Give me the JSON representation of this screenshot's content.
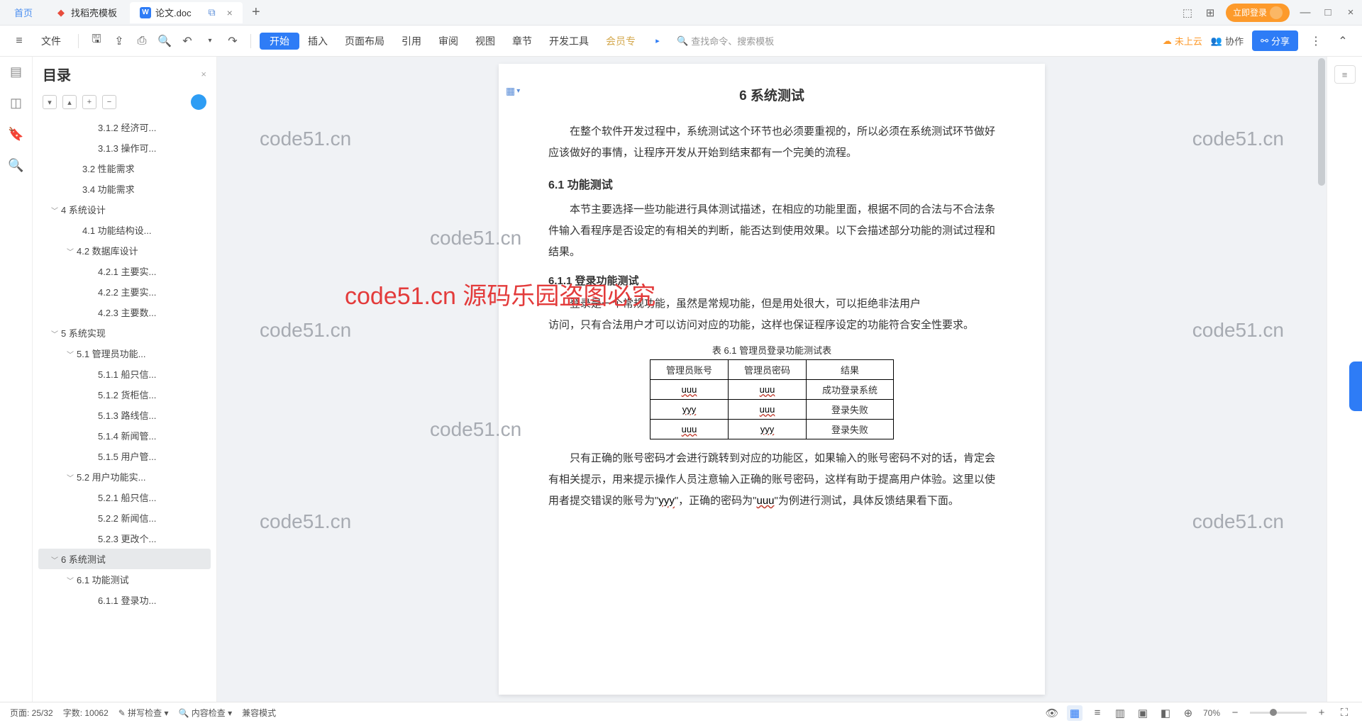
{
  "titlebar": {
    "home": "首页",
    "tab1": "找稻壳模板",
    "tab2": "论文.doc",
    "login": "立即登录"
  },
  "toolbar": {
    "file": "文件",
    "menus": [
      "开始",
      "插入",
      "页面布局",
      "引用",
      "审阅",
      "视图",
      "章节",
      "开发工具",
      "会员专"
    ],
    "search": "查找命令、搜索模板",
    "cloud": "未上云",
    "collab": "协作",
    "share": "分享"
  },
  "outline": {
    "title": "目录",
    "items": [
      {
        "t": "3.1.2 经济可...",
        "l": 4
      },
      {
        "t": "3.1.3 操作可...",
        "l": 4
      },
      {
        "t": "3.2 性能需求",
        "l": 3
      },
      {
        "t": "3.4 功能需求",
        "l": 3
      },
      {
        "t": "4 系统设计",
        "l": 1,
        "c": 1
      },
      {
        "t": "4.1 功能结构设...",
        "l": 3
      },
      {
        "t": "4.2 数据库设计",
        "l": 2,
        "c": 1
      },
      {
        "t": "4.2.1 主要实...",
        "l": 4
      },
      {
        "t": "4.2.2 主要实...",
        "l": 4
      },
      {
        "t": "4.2.3 主要数...",
        "l": 4
      },
      {
        "t": "5 系统实现",
        "l": 1,
        "c": 1
      },
      {
        "t": "5.1 管理员功能...",
        "l": 2,
        "c": 1
      },
      {
        "t": "5.1.1 船只信...",
        "l": 4
      },
      {
        "t": "5.1.2 货柜信...",
        "l": 4
      },
      {
        "t": "5.1.3 路线信...",
        "l": 4
      },
      {
        "t": "5.1.4 新闻管...",
        "l": 4
      },
      {
        "t": "5.1.5 用户管...",
        "l": 4
      },
      {
        "t": "5.2 用户功能实...",
        "l": 2,
        "c": 1
      },
      {
        "t": "5.2.1 船只信...",
        "l": 4
      },
      {
        "t": "5.2.2 新闻信...",
        "l": 4
      },
      {
        "t": "5.2.3 更改个...",
        "l": 4
      },
      {
        "t": "6 系统测试",
        "l": 1,
        "c": 1,
        "sel": 1
      },
      {
        "t": "6.1 功能测试",
        "l": 2,
        "c": 1
      },
      {
        "t": "6.1.1 登录功...",
        "l": 4
      }
    ]
  },
  "doc": {
    "h1": "6 系统测试",
    "p1": "在整个软件开发过程中，系统测试这个环节也必须要重视的，所以必须在系统测试环节做好应该做好的事情，让程序开发从开始到结束都有一个完美的流程。",
    "h2_1": "6.1 功能测试",
    "p2": "本节主要选择一些功能进行具体测试描述，在相应的功能里面，根据不同的合法与不合法条件输入看程序是否设定的有相关的判断，能否达到使用效果。以下会描述部分功能的测试过程和结果。",
    "h3_1": "6.1.1 登录功能测试",
    "p3a": "登录是一个常规功能，虽然是常规功能，但是用处很大，可以拒绝非法用户",
    "p3b": "访问，只有合法用户才可以访问对应的功能，这样也保证程序设定的功能符合安全性要求。",
    "caption": "表 6.1 管理员登录功能测试表",
    "th": [
      "管理员账号",
      "管理员密码",
      "结果"
    ],
    "rows": [
      [
        "uuu",
        "uuu",
        "成功登录系统"
      ],
      [
        "yyy",
        "uuu",
        "登录失败"
      ],
      [
        "uuu",
        "yyy",
        "登录失败"
      ]
    ],
    "p4a": "只有正确的账号密码才会进行跳转到对应的功能区，如果输入的账号密码不对的话，肯定会有相关提示，用来提示操作人员注意输入正确的账号密码，这样有助于提高用户体验。这里以使用者提交错误的账号为\"",
    "p4b": "\"，正确的密码为\"",
    "p4c": "\"为例进行测试，具体反馈结果看下面。",
    "yyy": "yyy",
    "uuu": "uuu"
  },
  "status": {
    "page": "页面: 25/32",
    "words": "字数: 10062",
    "spell": "拼写检查",
    "content": "内容检查",
    "compat": "兼容模式",
    "zoom": "70%"
  },
  "wm": "code51.cn",
  "wm_big": "code51.cn 源码乐园盗图必究"
}
